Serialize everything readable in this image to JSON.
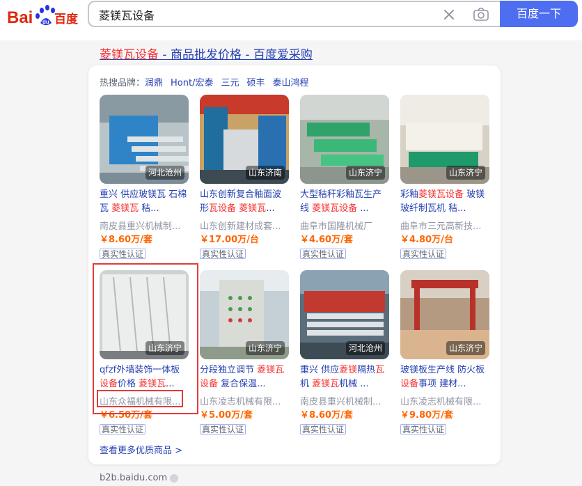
{
  "header": {
    "logo_text": "Bai百度",
    "search": {
      "value": "菱镁瓦设备",
      "placeholder": ""
    },
    "search_button_label": "百度一下"
  },
  "result": {
    "title_highlight": "菱镁瓦设备",
    "title_rest": " - 商品批发价格 - 百度爱采购",
    "hot_brands_label": "热搜品牌：",
    "hot_brands": [
      "润鼎",
      "Hont/宏泰",
      "三元",
      "硕丰",
      "泰山鸿程"
    ],
    "products": [
      {
        "location": "河北沧州",
        "title_parts": [
          {
            "t": "重兴 供应玻镁瓦 石棉瓦 ",
            "hl": false
          },
          {
            "t": "菱镁瓦",
            "hl": true
          },
          {
            "t": " 秸...",
            "hl": false
          }
        ],
        "seller": "南皮县重兴机械制...",
        "price": "￥8.60万/套",
        "verify": "真实性认证"
      },
      {
        "location": "山东济南",
        "title_parts": [
          {
            "t": "山东创新复合釉面波形",
            "hl": false
          },
          {
            "t": "瓦设备",
            "hl": true
          },
          {
            "t": " ",
            "hl": false
          },
          {
            "t": "菱镁瓦",
            "hl": true
          },
          {
            "t": "...",
            "hl": false
          }
        ],
        "seller": "山东创新建材成套...",
        "price": "￥17.00万/台",
        "verify": "真实性认证"
      },
      {
        "location": "山东济宁",
        "title_parts": [
          {
            "t": "大型秸秆彩釉瓦生产线 ",
            "hl": false
          },
          {
            "t": "菱镁瓦设备",
            "hl": true
          },
          {
            "t": " ...",
            "hl": false
          }
        ],
        "seller": "曲阜市国隆机械厂",
        "price": "￥4.60万/套",
        "verify": "真实性认证"
      },
      {
        "location": "山东济宁",
        "title_parts": [
          {
            "t": "彩釉",
            "hl": false
          },
          {
            "t": "菱镁瓦设备",
            "hl": true
          },
          {
            "t": " 玻镁玻纤制瓦机 秸...",
            "hl": false
          }
        ],
        "seller": "曲阜市三元高新技...",
        "price": "￥4.80万/台",
        "verify": "真实性认证"
      },
      {
        "location": "山东济宁",
        "title_parts": [
          {
            "t": "qfzf外墙装饰一体板",
            "hl": false
          },
          {
            "t": "设备",
            "hl": true
          },
          {
            "t": "价格 ",
            "hl": false
          },
          {
            "t": "菱镁瓦",
            "hl": true
          },
          {
            "t": "...",
            "hl": false
          }
        ],
        "seller": "山东众福机械有限...",
        "price": "￥6.50万/套",
        "verify": "真实性认证"
      },
      {
        "location": "山东济宁",
        "title_parts": [
          {
            "t": "分段独立调节 ",
            "hl": false
          },
          {
            "t": "菱镁瓦设备",
            "hl": true
          },
          {
            "t": " 复合保温...",
            "hl": false
          }
        ],
        "seller": "山东凌志机械有限...",
        "price": "￥5.00万/套",
        "verify": "真实性认证"
      },
      {
        "location": "河北沧州",
        "title_parts": [
          {
            "t": "重兴 供应",
            "hl": false
          },
          {
            "t": "菱镁",
            "hl": true
          },
          {
            "t": "隔热",
            "hl": false
          },
          {
            "t": "瓦",
            "hl": true
          },
          {
            "t": "机 ",
            "hl": false
          },
          {
            "t": "菱镁瓦",
            "hl": true
          },
          {
            "t": "机械 ...",
            "hl": false
          }
        ],
        "seller": "南皮县重兴机械制...",
        "price": "￥8.60万/套",
        "verify": "真实性认证"
      },
      {
        "location": "山东济宁",
        "title_parts": [
          {
            "t": "玻镁板生产线 防火板",
            "hl": false
          },
          {
            "t": "设备",
            "hl": true
          },
          {
            "t": "事项 建材...",
            "hl": false
          }
        ],
        "seller": "山东凌志机械有限...",
        "price": "￥9.80万/套",
        "verify": "真实性认证"
      }
    ],
    "more_link": "查看更多优质商品 >",
    "source": "b2b.baidu.com"
  },
  "colors": {
    "accent": "#4e6ef2",
    "link": "#2440b3",
    "highlight": "#f73131",
    "price": "#ff6600",
    "annotation": "#e03b3b"
  }
}
